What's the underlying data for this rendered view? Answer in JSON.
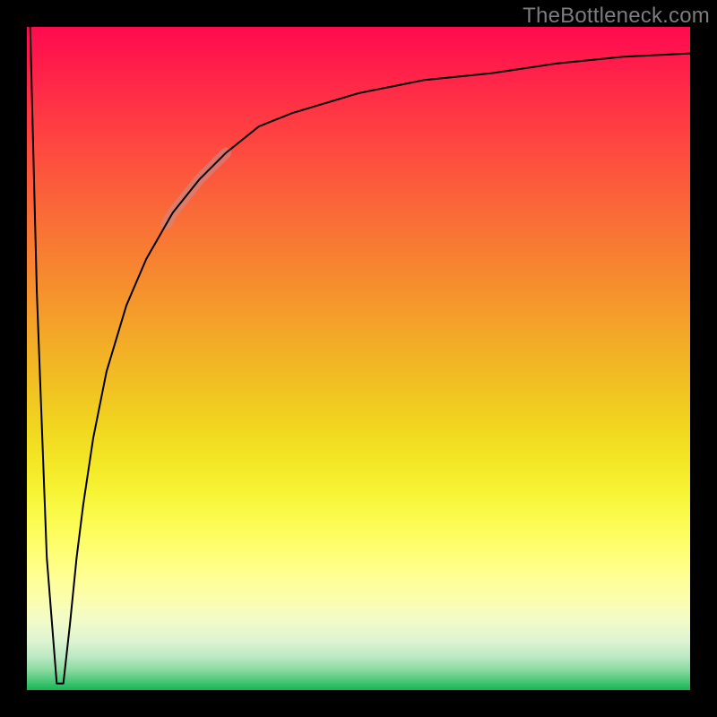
{
  "watermark": "TheBottleneck.com",
  "chart_data": {
    "type": "line",
    "title": "",
    "xlabel": "",
    "ylabel": "",
    "xlim": [
      0,
      100
    ],
    "ylim": [
      0,
      100
    ],
    "grid": false,
    "legend": false,
    "description": "Black curve on rainbow gradient. Spike at x≈0 drops from y≈100 to y≈0 at x≈5, then rises asymptotically toward y≈96 as x→100. A translucent pale-red highlight marks the curve segment roughly x∈[21,30].",
    "series": [
      {
        "name": "curve",
        "color": "#000000",
        "x": [
          0.5,
          1.5,
          3,
          4.5,
          5.5,
          6.5,
          7.5,
          8.5,
          10,
          12,
          15,
          18,
          22,
          26,
          30,
          35,
          40,
          50,
          60,
          70,
          80,
          90,
          100
        ],
        "y": [
          100,
          60,
          20,
          1,
          1,
          10,
          20,
          28,
          38,
          48,
          58,
          65,
          72,
          77,
          81,
          85,
          87,
          90,
          92,
          93,
          94.5,
          95.5,
          96
        ]
      }
    ],
    "highlight": {
      "x_range": [
        21,
        30
      ],
      "color": "#c98a8a",
      "alpha": 0.6,
      "width": 12
    },
    "background_gradient": {
      "orientation": "vertical",
      "stops": [
        {
          "pos": 0.0,
          "color": "#ff0a4f"
        },
        {
          "pos": 0.05,
          "color": "#ff1b4b"
        },
        {
          "pos": 0.1,
          "color": "#ff2d47"
        },
        {
          "pos": 0.15,
          "color": "#ff3e42"
        },
        {
          "pos": 0.2,
          "color": "#fd4f3e"
        },
        {
          "pos": 0.25,
          "color": "#fb603a"
        },
        {
          "pos": 0.3,
          "color": "#f97136"
        },
        {
          "pos": 0.35,
          "color": "#f78131"
        },
        {
          "pos": 0.4,
          "color": "#f5922d"
        },
        {
          "pos": 0.45,
          "color": "#f4a329"
        },
        {
          "pos": 0.5,
          "color": "#f2b425"
        },
        {
          "pos": 0.55,
          "color": "#f1c422"
        },
        {
          "pos": 0.6,
          "color": "#f1d520"
        },
        {
          "pos": 0.65,
          "color": "#f3e524"
        },
        {
          "pos": 0.7,
          "color": "#f7f334"
        },
        {
          "pos": 0.74,
          "color": "#fbfb4d"
        },
        {
          "pos": 0.78,
          "color": "#fefe6b"
        },
        {
          "pos": 0.82,
          "color": "#ffff8b"
        },
        {
          "pos": 0.86,
          "color": "#fcfeab"
        },
        {
          "pos": 0.895,
          "color": "#f3fbc8"
        },
        {
          "pos": 0.925,
          "color": "#dff4d2"
        },
        {
          "pos": 0.95,
          "color": "#bce9c3"
        },
        {
          "pos": 0.97,
          "color": "#8bdba1"
        },
        {
          "pos": 0.985,
          "color": "#52c97c"
        },
        {
          "pos": 1.0,
          "color": "#18b657"
        }
      ]
    }
  }
}
